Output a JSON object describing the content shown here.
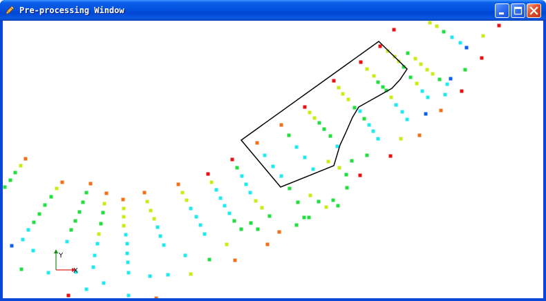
{
  "window": {
    "title": "Pre-processing Window",
    "icon": "pencil-icon"
  },
  "title_buttons": [
    "minimize-icon",
    "maximize-icon",
    "close-icon"
  ],
  "axes": {
    "x_label": "X",
    "y_label": "Y",
    "x_color": "#e02020",
    "y_color": "#109010"
  },
  "colors": {
    "red": "#e81010",
    "orange": "#f07018",
    "yellow": "#c8ec18",
    "green": "#20e040",
    "cyan": "#20e8f0",
    "blue": "#1060f0",
    "selection": "#000000",
    "titlebar": "#0453e0"
  }
}
